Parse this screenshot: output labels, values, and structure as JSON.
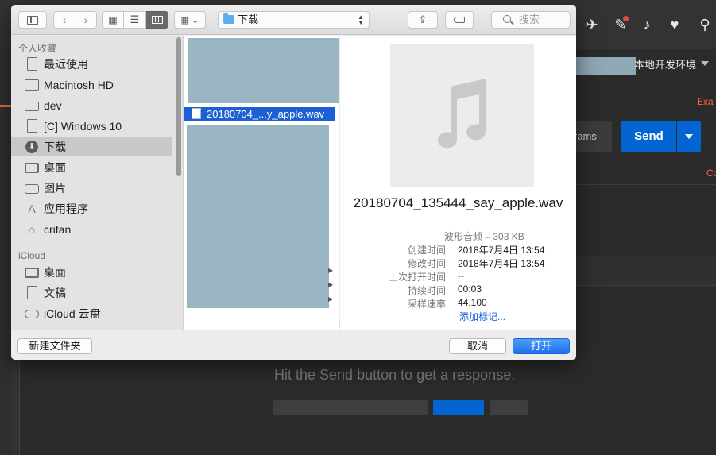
{
  "background": {
    "env_label": "本地开发环境",
    "tab_partial": "Exa",
    "side_partial": "Co",
    "params_partial": "rams",
    "send_label": "Send",
    "hint": "Hit the Send button to get a response."
  },
  "dialog": {
    "path_label": "下载",
    "search_placeholder": "搜索",
    "sidebar": {
      "favorites_header": "个人收藏",
      "favorites": [
        {
          "label": "最近使用",
          "icon": "recent-icon"
        },
        {
          "label": "Macintosh HD",
          "icon": "hard-disk-icon"
        },
        {
          "label": "dev",
          "icon": "folder-icon"
        },
        {
          "label": "[C] Windows 10",
          "icon": "document-icon"
        },
        {
          "label": "下载",
          "icon": "download-icon",
          "selected": true
        },
        {
          "label": "桌面",
          "icon": "desktop-icon"
        },
        {
          "label": "图片",
          "icon": "camera-icon"
        },
        {
          "label": "应用程序",
          "icon": "applications-icon"
        },
        {
          "label": "crifan",
          "icon": "home-icon"
        }
      ],
      "icloud_header": "iCloud",
      "icloud": [
        {
          "label": "桌面",
          "icon": "desktop-icon"
        },
        {
          "label": "文稿",
          "icon": "document-icon"
        },
        {
          "label": "iCloud 云盘",
          "icon": "cloud-icon"
        }
      ]
    },
    "file_selected": "20180704_...y_apple.wav",
    "preview": {
      "filename": "20180704_135444_say_apple.wav",
      "kind": "波形音频 – 303 KB",
      "meta": [
        {
          "label": "创建时间",
          "value": "2018年7月4日 13:54"
        },
        {
          "label": "修改时间",
          "value": "2018年7月4日 13:54"
        },
        {
          "label": "上次打开时间",
          "value": "--"
        },
        {
          "label": "持续时间",
          "value": "00:03"
        },
        {
          "label": "采样速率",
          "value": "44,100"
        }
      ],
      "add_tag": "添加标记..."
    },
    "new_folder": "新建文件夹",
    "cancel": "取消",
    "open": "打开"
  }
}
